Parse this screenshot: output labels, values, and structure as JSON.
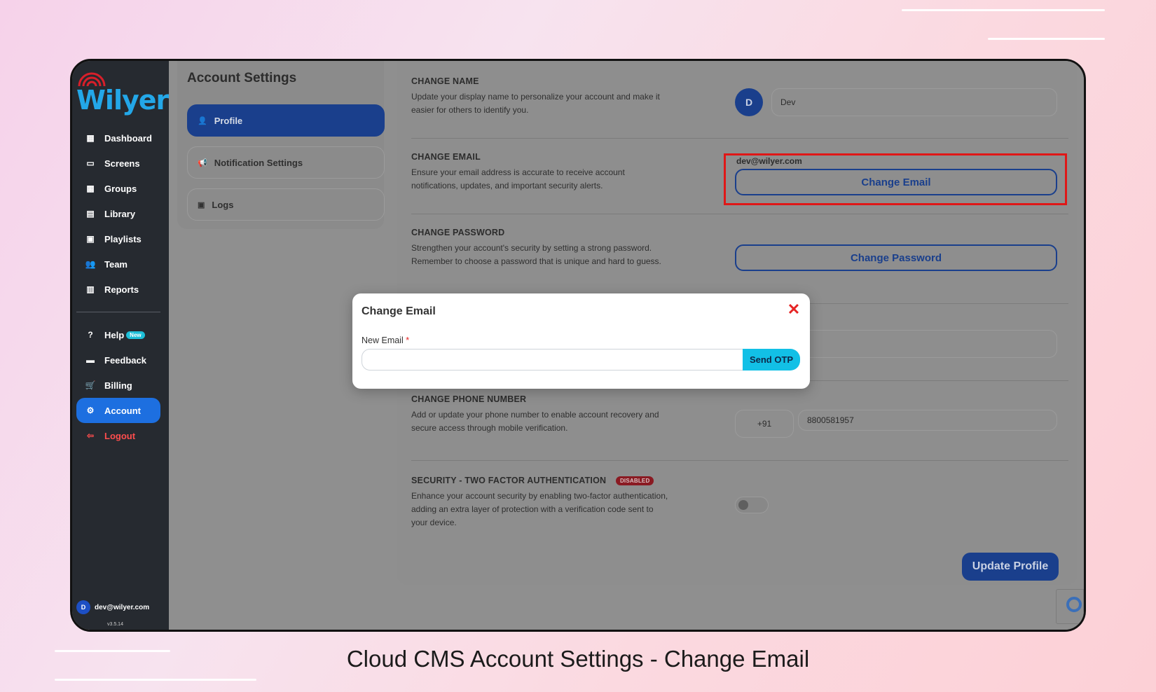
{
  "brand": {
    "name": "Wilyer"
  },
  "sidebar": {
    "items": [
      {
        "label": "Dashboard",
        "icon": "dashboard-icon"
      },
      {
        "label": "Screens",
        "icon": "screen-icon"
      },
      {
        "label": "Groups",
        "icon": "groups-icon"
      },
      {
        "label": "Library",
        "icon": "library-icon"
      },
      {
        "label": "Playlists",
        "icon": "playlist-icon"
      },
      {
        "label": "Team",
        "icon": "team-icon"
      },
      {
        "label": "Reports",
        "icon": "reports-icon"
      }
    ],
    "secondary": [
      {
        "label": "Help",
        "badge": "New",
        "icon": "help-icon"
      },
      {
        "label": "Feedback",
        "icon": "feedback-icon"
      },
      {
        "label": "Billing",
        "icon": "cart-icon"
      },
      {
        "label": "Account",
        "icon": "gear-icon",
        "active": true
      },
      {
        "label": "Logout",
        "icon": "logout-icon"
      }
    ],
    "user": {
      "initial": "D",
      "email": "dev@wilyer.com"
    },
    "version": "v3.5.14"
  },
  "settings": {
    "title": "Account Settings",
    "items": [
      {
        "label": "Profile",
        "icon": "user-icon",
        "active": true
      },
      {
        "label": "Notification Settings",
        "icon": "megaphone-icon"
      },
      {
        "label": "Logs",
        "icon": "terminal-icon"
      }
    ]
  },
  "profile": {
    "change_name": {
      "title": "CHANGE NAME",
      "desc": "Update your display name to personalize your account and make it easier for others to identify you.",
      "initial": "D",
      "value": "Dev"
    },
    "change_email": {
      "title": "CHANGE EMAIL",
      "desc": "Ensure your email address is accurate to receive account notifications, updates, and important security alerts.",
      "current": "dev@wilyer.com",
      "button": "Change Email"
    },
    "change_password": {
      "title": "CHANGE PASSWORD",
      "desc": "Strengthen your account's security by setting a strong password. Remember to choose a password that is unique and hard to guess.",
      "button": "Change Password"
    },
    "change_phone": {
      "title": "CHANGE PHONE NUMBER",
      "desc": "Add or update your phone number to enable account recovery and secure access through mobile verification.",
      "country_code": "+91",
      "number": "8800581957"
    },
    "two_factor": {
      "title": "SECURITY - TWO FACTOR AUTHENTICATION",
      "status": "DISABLED",
      "desc": "Enhance your account security by enabling two-factor authentication, adding an extra layer of protection with a verification code sent to your device.",
      "enabled": false
    },
    "update_button": "Update Profile"
  },
  "modal": {
    "title": "Change Email",
    "field_label": "New Email",
    "required_mark": "*",
    "input_value": "",
    "button": "Send OTP"
  },
  "caption": "Cloud CMS Account Settings - Change Email",
  "colors": {
    "accent": "#1d6fe0",
    "highlight": "#e01717",
    "otp_button": "#12c0e6"
  }
}
